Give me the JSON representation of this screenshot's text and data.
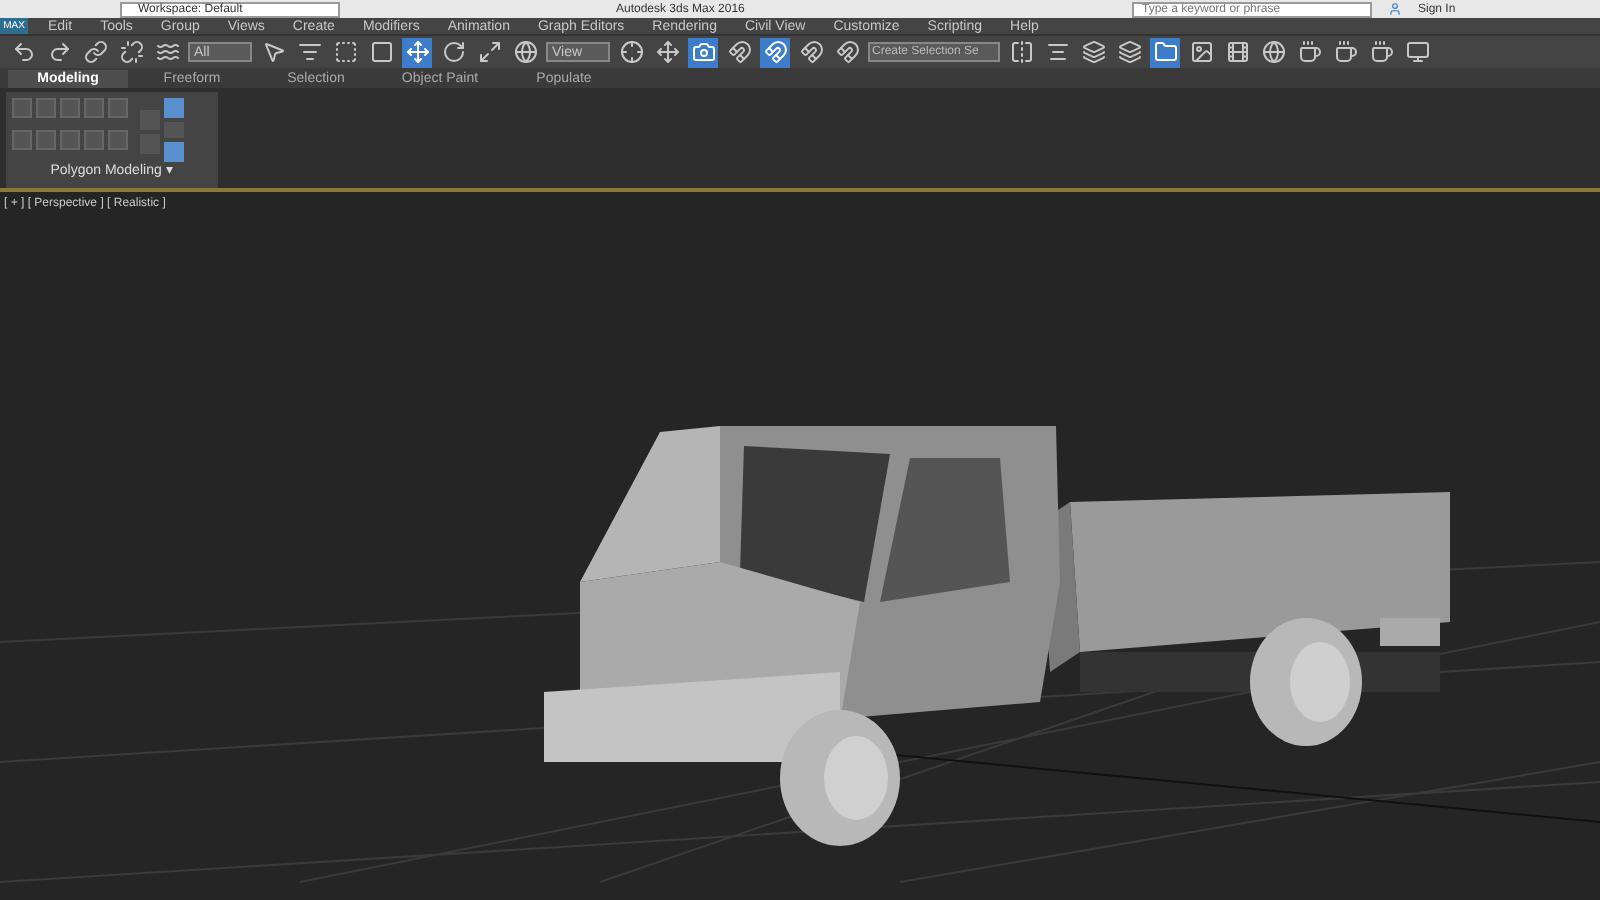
{
  "title_bar": {
    "workspace": "Workspace: Default",
    "title": "Autodesk 3ds Max 2016",
    "search": {
      "placeholder": "Type a keyword or phrase"
    },
    "sign_in": "Sign In"
  },
  "app_button": {
    "label": "MAX"
  },
  "menu": [
    "Edit",
    "Tools",
    "Group",
    "Views",
    "Create",
    "Modifiers",
    "Animation",
    "Graph Editors",
    "Rendering",
    "Civil View",
    "Customize",
    "Scripting",
    "Help"
  ],
  "toolbar": {
    "selection_filter": "All",
    "reference_coord": "View",
    "named_selection": {
      "placeholder": "Create Selection Se"
    }
  },
  "ribbon": {
    "tabs": [
      {
        "label": "Modeling",
        "selected": true
      },
      {
        "label": "Freeform",
        "selected": false
      },
      {
        "label": "Selection",
        "selected": false
      },
      {
        "label": "Object Paint",
        "selected": false
      },
      {
        "label": "Populate",
        "selected": false
      }
    ],
    "panel_label": "Polygon Modeling ▾"
  },
  "viewport": {
    "label": "[ + ] [ Perspective ] [ Realistic ]"
  }
}
